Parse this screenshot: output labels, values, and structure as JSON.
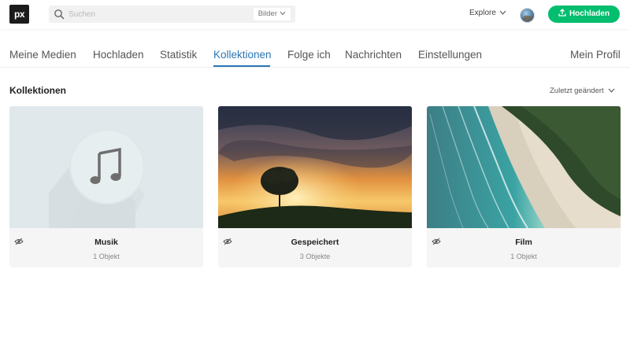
{
  "header": {
    "logo_text": "px",
    "search": {
      "placeholder": "Suchen",
      "type_label": "Bilder"
    },
    "explore_label": "Explore",
    "upload_label": "Hochladen",
    "brand_color": "#02be6e"
  },
  "tabs": {
    "left": [
      {
        "label": "Meine Medien"
      },
      {
        "label": "Hochladen"
      },
      {
        "label": "Statistik"
      },
      {
        "label": "Kollektionen",
        "active": true
      },
      {
        "label": "Folge ich"
      },
      {
        "label": "Nachrichten"
      },
      {
        "label": "Einstellungen"
      }
    ],
    "right": {
      "label": "Mein Profil"
    },
    "active_color": "#2a75b3"
  },
  "section": {
    "title": "Kollektionen",
    "sort_label": "Zuletzt geändert"
  },
  "collections": [
    {
      "title": "Musik",
      "count": "1 Objekt",
      "private": true,
      "thumbnail": "music-note-placeholder"
    },
    {
      "title": "Gespeichert",
      "count": "3 Objekte",
      "private": true,
      "thumbnail": "sunset-tree-photo"
    },
    {
      "title": "Film",
      "count": "1 Objekt",
      "private": true,
      "thumbnail": "aerial-beach-photo"
    }
  ]
}
